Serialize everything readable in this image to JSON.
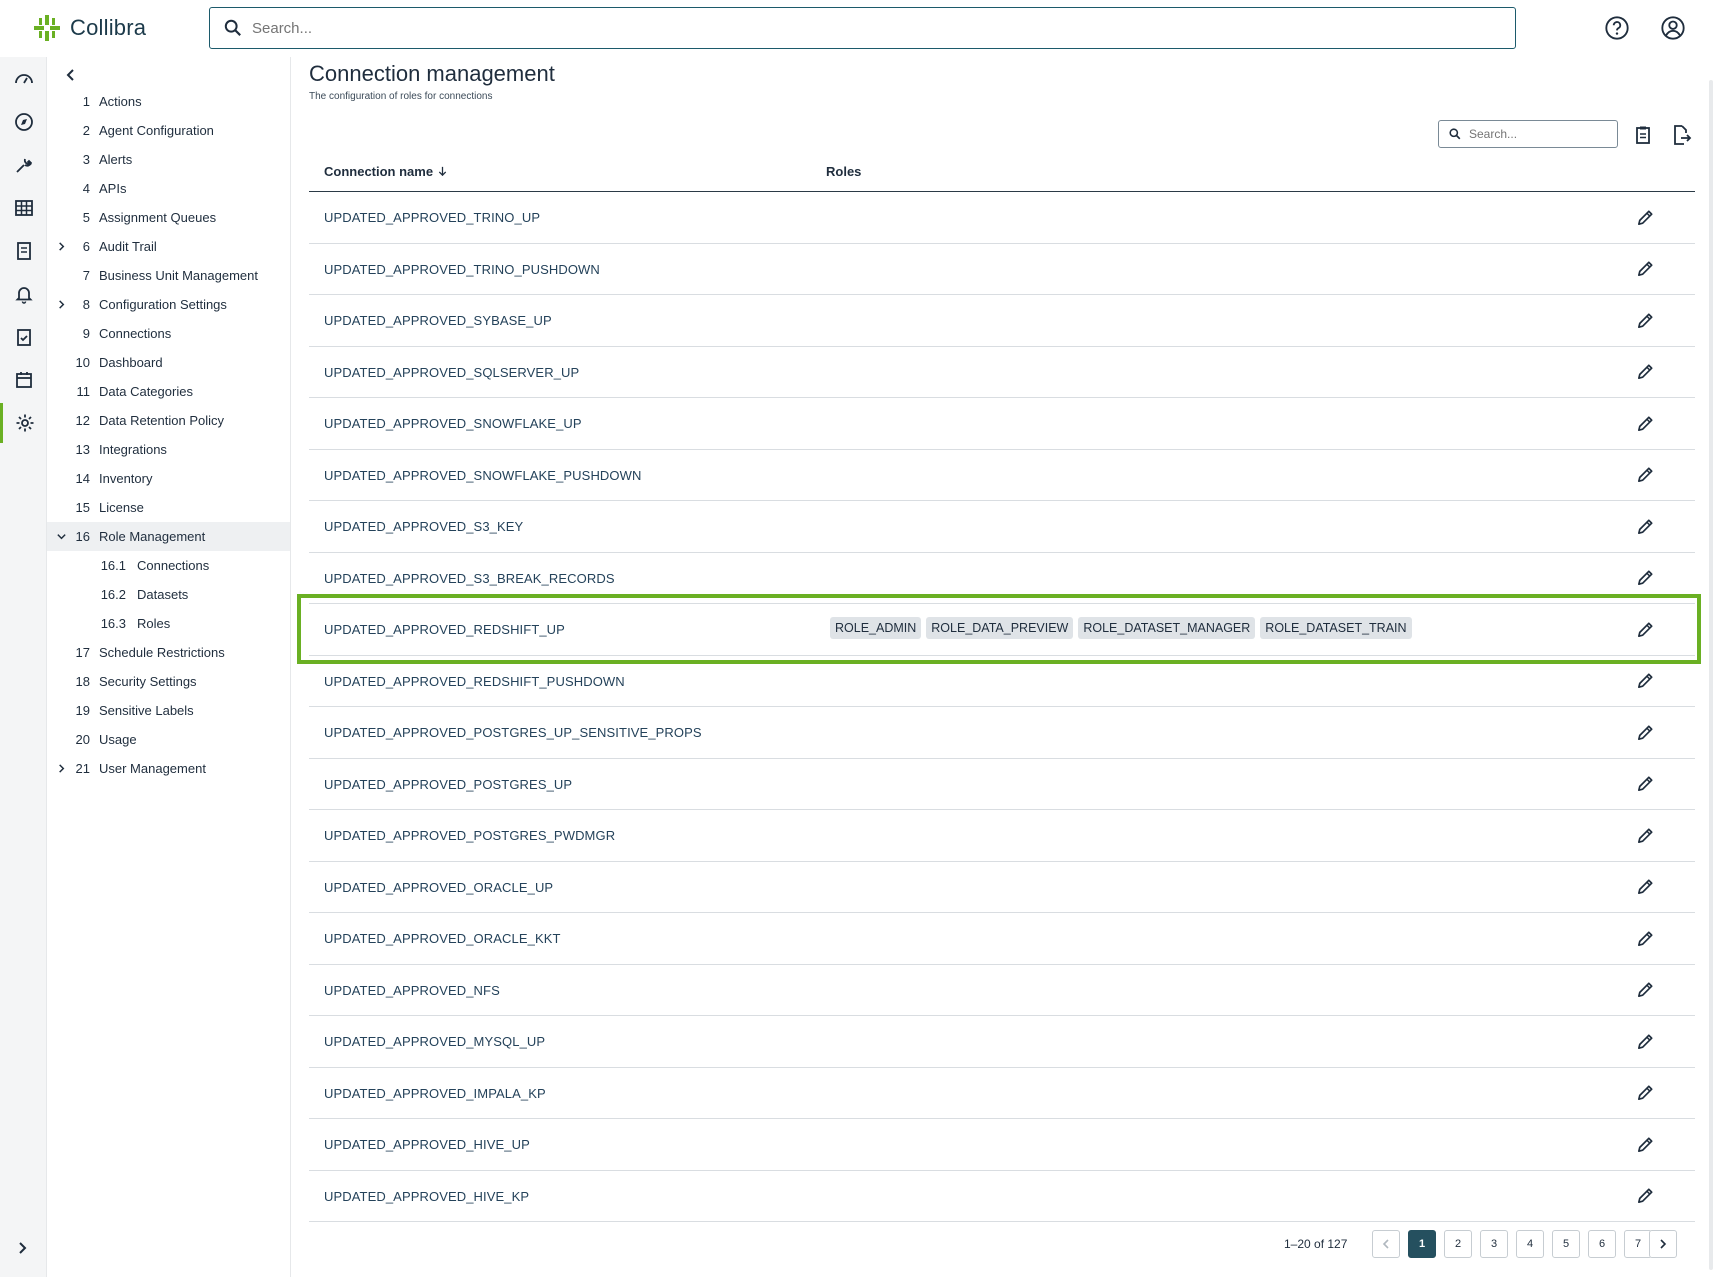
{
  "app": {
    "name": "Collibra"
  },
  "header": {
    "search_placeholder": "Search...",
    "help_icon": "help-circle-icon",
    "user_icon": "user-circle-icon"
  },
  "rail": {
    "items": [
      "dashboard-gauge-icon",
      "explore-compass-icon",
      "wrench-icon",
      "table-grid-icon",
      "report-icon",
      "bell-icon",
      "clipboard-check-icon",
      "calendar-icon",
      "gear-icon"
    ],
    "active": "gear-icon"
  },
  "nav": {
    "items": [
      {
        "num": "1",
        "label": "Actions"
      },
      {
        "num": "2",
        "label": "Agent Configuration"
      },
      {
        "num": "3",
        "label": "Alerts"
      },
      {
        "num": "4",
        "label": "APIs"
      },
      {
        "num": "5",
        "label": "Assignment Queues"
      },
      {
        "num": "6",
        "label": "Audit Trail",
        "expandable": true
      },
      {
        "num": "7",
        "label": "Business Unit Management"
      },
      {
        "num": "8",
        "label": "Configuration Settings",
        "expandable": true
      },
      {
        "num": "9",
        "label": "Connections"
      },
      {
        "num": "10",
        "label": "Dashboard"
      },
      {
        "num": "11",
        "label": "Data Categories"
      },
      {
        "num": "12",
        "label": "Data Retention Policy"
      },
      {
        "num": "13",
        "label": "Integrations"
      },
      {
        "num": "14",
        "label": "Inventory"
      },
      {
        "num": "15",
        "label": "License"
      },
      {
        "num": "16",
        "label": "Role Management",
        "expanded": true
      },
      {
        "num": "16.1",
        "label": "Connections",
        "sub": true
      },
      {
        "num": "16.2",
        "label": "Datasets",
        "sub": true
      },
      {
        "num": "16.3",
        "label": "Roles",
        "sub": true
      },
      {
        "num": "17",
        "label": "Schedule Restrictions"
      },
      {
        "num": "18",
        "label": "Security Settings"
      },
      {
        "num": "19",
        "label": "Sensitive Labels"
      },
      {
        "num": "20",
        "label": "Usage"
      },
      {
        "num": "21",
        "label": "User Management",
        "expandable": true
      }
    ]
  },
  "main": {
    "title": "Connection management",
    "subtitle": "The configuration of roles for connections",
    "table_search_placeholder": "Search...",
    "columns": {
      "name": "Connection name",
      "roles": "Roles"
    },
    "rows": [
      {
        "name": "UPDATED_APPROVED_TRINO_UP",
        "roles": []
      },
      {
        "name": "UPDATED_APPROVED_TRINO_PUSHDOWN",
        "roles": []
      },
      {
        "name": "UPDATED_APPROVED_SYBASE_UP",
        "roles": []
      },
      {
        "name": "UPDATED_APPROVED_SQLSERVER_UP",
        "roles": []
      },
      {
        "name": "UPDATED_APPROVED_SNOWFLAKE_UP",
        "roles": []
      },
      {
        "name": "UPDATED_APPROVED_SNOWFLAKE_PUSHDOWN",
        "roles": []
      },
      {
        "name": "UPDATED_APPROVED_S3_KEY",
        "roles": []
      },
      {
        "name": "UPDATED_APPROVED_S3_BREAK_RECORDS",
        "roles": []
      },
      {
        "name": "UPDATED_APPROVED_REDSHIFT_UP",
        "roles": [
          "ROLE_ADMIN",
          "ROLE_DATA_PREVIEW",
          "ROLE_DATASET_MANAGER",
          "ROLE_DATASET_TRAIN"
        ],
        "highlighted": true
      },
      {
        "name": "UPDATED_APPROVED_REDSHIFT_PUSHDOWN",
        "roles": []
      },
      {
        "name": "UPDATED_APPROVED_POSTGRES_UP_SENSITIVE_PROPS",
        "roles": []
      },
      {
        "name": "UPDATED_APPROVED_POSTGRES_UP",
        "roles": []
      },
      {
        "name": "UPDATED_APPROVED_POSTGRES_PWDMGR",
        "roles": []
      },
      {
        "name": "UPDATED_APPROVED_ORACLE_UP",
        "roles": []
      },
      {
        "name": "UPDATED_APPROVED_ORACLE_KKT",
        "roles": []
      },
      {
        "name": "UPDATED_APPROVED_NFS",
        "roles": []
      },
      {
        "name": "UPDATED_APPROVED_MYSQL_UP",
        "roles": []
      },
      {
        "name": "UPDATED_APPROVED_IMPALA_KP",
        "roles": []
      },
      {
        "name": "UPDATED_APPROVED_HIVE_UP",
        "roles": []
      },
      {
        "name": "UPDATED_APPROVED_HIVE_KP",
        "roles": []
      }
    ],
    "pagination": {
      "range": "1–20 of 127",
      "pages": [
        "1",
        "2",
        "3",
        "4",
        "5",
        "6",
        "7"
      ],
      "current": "1"
    }
  },
  "colors": {
    "accent": "#6ab023",
    "primary": "#25505f"
  }
}
